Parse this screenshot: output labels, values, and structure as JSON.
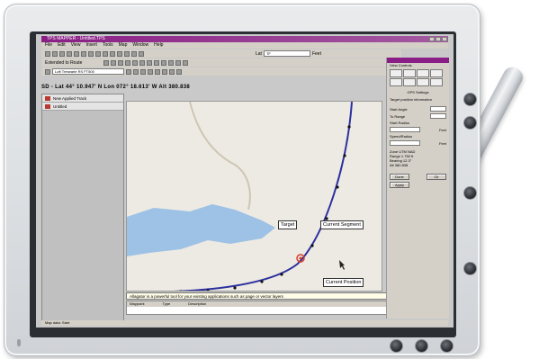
{
  "window": {
    "title": "TPS MAPPER - Untitled.TPS"
  },
  "menubar": {
    "items": [
      "File",
      "Edit",
      "View",
      "Insert",
      "Tools",
      "Map",
      "Window",
      "Help"
    ]
  },
  "toolbar1": {
    "field_label": "Lat",
    "field_value": "TF",
    "unit": "Feet"
  },
  "toolbar2": {
    "label": "Extended to Route"
  },
  "toolbar3": {
    "combo_value": "Loft Tresearle RS FT500"
  },
  "coordinates": "SD - Lat 44° 10.947' N  Lon 072° 18.613' W  Alt 380.838",
  "left_panel": {
    "items": [
      {
        "label": "New Applied Track"
      },
      {
        "label": "Untitled"
      }
    ]
  },
  "map": {
    "target_label": "Target",
    "current_segment_label": "Current Segment",
    "current_position_label": "Current Position",
    "colors": {
      "water": "#9ec1e6",
      "route": "#2d2fa0",
      "road": "#cfc6b4",
      "land": "#eceae2",
      "target": "#d33c2a"
    }
  },
  "info_bar": "Allagator is a powerful tool for your existing applications such as page or vector layers",
  "grid": {
    "columns": [
      "Waypoint",
      "Type",
      "Description"
    ]
  },
  "status_bar": "Map data: Start",
  "right_panel": {
    "header": "View Controls",
    "section_title": "GPS Settings",
    "line1": "Target position information",
    "field_labels": [
      "Start Angle",
      "To Range",
      "Start Radius",
      "Speed/Radius"
    ],
    "field_units": [
      "",
      "",
      "Feet",
      "Feet"
    ],
    "readouts": [
      "Zone    UTM NAD",
      "Range   1.750 ft",
      "Bearing 12.3°",
      "Alt     380.838"
    ],
    "button_left": "Done",
    "button_right": "Clr",
    "button_bottom": "Apply"
  }
}
